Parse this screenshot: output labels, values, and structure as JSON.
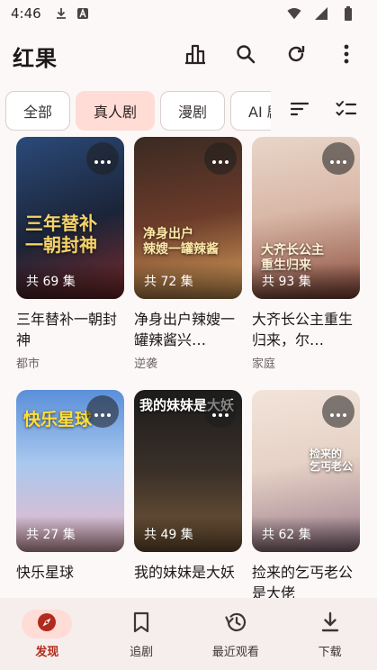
{
  "status_bar": {
    "time": "4:46",
    "icons": [
      "download-icon",
      "text-a-icon",
      "wifi-icon",
      "cellular-icon",
      "battery-icon"
    ]
  },
  "app_bar": {
    "title": "红果",
    "actions": [
      "ranking-icon",
      "search-icon",
      "refresh-icon",
      "more-vert-icon"
    ]
  },
  "chips": [
    {
      "label": "全部",
      "selected": false
    },
    {
      "label": "真人剧",
      "selected": true
    },
    {
      "label": "漫剧",
      "selected": false
    },
    {
      "label": "AI 剧",
      "selected": false
    }
  ],
  "chip_tools": [
    "sort-icon",
    "checklist-icon"
  ],
  "cards": [
    {
      "title": "三年替补一朝封神",
      "tag": "都市",
      "episodes": "共 69 集",
      "poster_text": "三年替补\n一朝封神",
      "colors": [
        "#2b4a7a",
        "#7b2a2a"
      ]
    },
    {
      "title": "净身出户辣嫂一罐辣酱兴…",
      "tag": "逆袭",
      "episodes": "共 72 集",
      "poster_text": "净身出户\n辣嫂一罐辣酱",
      "colors": [
        "#6b3b2a",
        "#d9a05b"
      ]
    },
    {
      "title": "大齐长公主重生归来，尔…",
      "tag": "家庭",
      "episodes": "共 93 集",
      "poster_text": "大齐长公主\n重生归来",
      "colors": [
        "#d9b8a8",
        "#8a4a3a"
      ]
    },
    {
      "title": "快乐星球",
      "tag": "",
      "episodes": "共 27 集",
      "poster_text": "快乐星球",
      "colors": [
        "#5a8fd9",
        "#f0b9c6"
      ]
    },
    {
      "title": "我的妹妹是大妖",
      "tag": "",
      "episodes": "共 49 集",
      "poster_text": "我的妹妹是大妖",
      "colors": [
        "#2a2a2a",
        "#7a5a3a"
      ]
    },
    {
      "title": "捡来的乞丐老公是大佬",
      "tag": "",
      "episodes": "共 62 集",
      "poster_text": "捡来的\n乞丐老公",
      "colors": [
        "#e6d2c6",
        "#9a7a8a"
      ]
    }
  ],
  "bottom_nav": [
    {
      "label": "发现",
      "icon": "compass-icon",
      "active": true
    },
    {
      "label": "追剧",
      "icon": "bookmark-icon",
      "active": false
    },
    {
      "label": "最近观看",
      "icon": "history-icon",
      "active": false
    },
    {
      "label": "下载",
      "icon": "download-icon",
      "active": false
    }
  ],
  "colors": {
    "accent": "#b02b1d",
    "selected_chip": "#ffdcd6",
    "background": "#fbf8f7",
    "nav_background": "#f6eeec"
  }
}
